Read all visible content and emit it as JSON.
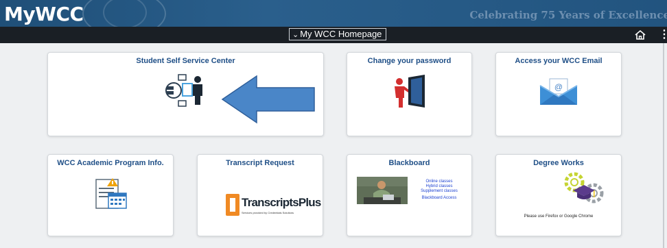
{
  "header": {
    "logo_text": "MyWCC",
    "tagline": "Celebrating 75 Years of Excellence"
  },
  "navbar": {
    "homepage_dropdown": "My WCC Homepage",
    "home_icon": "home-icon",
    "menu_icon": "more-vertical-icon"
  },
  "colors": {
    "banner": "#22547f",
    "navbar": "#1a1f25",
    "tile_title": "#1e4e86",
    "arrow": "#4a86c8",
    "page_bg": "#eef0f2"
  },
  "tiles": [
    {
      "title": "Student Self Service Center",
      "icon": "self-service-icon"
    },
    {
      "title": "Change your password",
      "icon": "password-door-icon"
    },
    {
      "title": "Access your WCC Email",
      "icon": "email-envelope-icon"
    },
    {
      "title": "WCC Academic Program Info.",
      "icon": "calendar-document-icon"
    },
    {
      "title": "Transcript Request",
      "icon": "transcriptsplus-logo",
      "logo_main": "TranscriptsPlus",
      "logo_sub": "Services provided by Credentials Solutions"
    },
    {
      "title": "Blackboard",
      "icon": "blackboard-photo",
      "lines": [
        "Online classes",
        "Hybrid classes",
        "Supplement classes",
        "Blackboard Access"
      ]
    },
    {
      "title": "Degree Works",
      "icon": "graduation-gears-icon",
      "note": "Please use Firefox or Google Chrome"
    }
  ]
}
